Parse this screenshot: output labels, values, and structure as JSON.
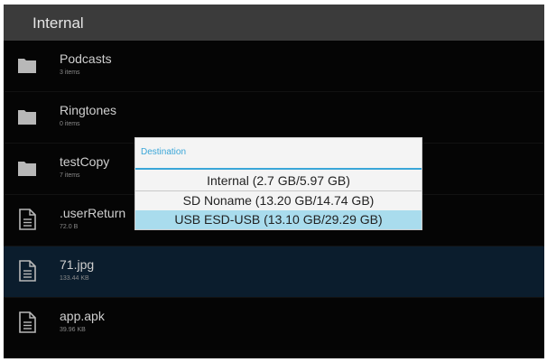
{
  "header": {
    "title": "Internal"
  },
  "files": [
    {
      "name": "Podcasts",
      "meta": "3 items",
      "type": "folder"
    },
    {
      "name": "Ringtones",
      "meta": "0 items",
      "type": "folder"
    },
    {
      "name": "testCopy",
      "meta": "7 items",
      "type": "folder"
    },
    {
      "name": ".userReturn",
      "meta": "72.0 B",
      "type": "file"
    },
    {
      "name": "71.jpg",
      "meta": "133.44 KB",
      "type": "file",
      "selected": true
    },
    {
      "name": "app.apk",
      "meta": "39.96 KB",
      "type": "file"
    }
  ],
  "dialog": {
    "title": "Destination",
    "options": [
      {
        "label": "Internal (2.7 GB/5.97 GB)"
      },
      {
        "label": "SD Noname (13.20 GB/14.74 GB)"
      },
      {
        "label": "USB ESD-USB (13.10 GB/29.29 GB)",
        "selected": true
      }
    ]
  },
  "colors": {
    "background": "#050505",
    "header": "#3b3b3b",
    "selected_row": "#0b1d2d",
    "accent": "#3aa6d8",
    "selected_option": "#a9dced"
  }
}
